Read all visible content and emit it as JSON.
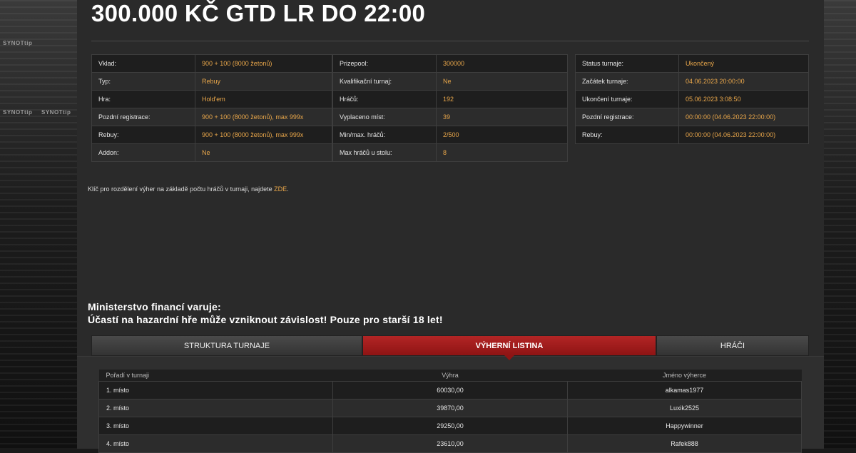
{
  "brand": "SYNOTtip",
  "title": "300.000 KČ GTD LR DO 22:00",
  "info_col1": [
    {
      "label": "Vklad:",
      "value": "900 + 100 (8000 žetonů)"
    },
    {
      "label": "Typ:",
      "value": "Rebuy"
    },
    {
      "label": "Hra:",
      "value": "Hold'em"
    },
    {
      "label": "Pozdní registrace:",
      "value": "900 + 100 (8000 žetonů), max 999x"
    },
    {
      "label": "Rebuy:",
      "value": "900 + 100 (8000 žetonů), max 999x"
    },
    {
      "label": "Addon:",
      "value": "Ne"
    }
  ],
  "info_col2": [
    {
      "label": "Prizepool:",
      "value": "300000"
    },
    {
      "label": "Kvalifikační turnaj:",
      "value": "Ne"
    },
    {
      "label": "Hráčů:",
      "value": "192"
    },
    {
      "label": "Vyplaceno míst:",
      "value": "39"
    },
    {
      "label": "Min/max. hráčů:",
      "value": "2/500"
    },
    {
      "label": "Max hráčů u stolu:",
      "value": "8"
    }
  ],
  "info_col3": [
    {
      "label": "Status turnaje:",
      "value": "Ukončený"
    },
    {
      "label": "Začátek turnaje:",
      "value": "04.06.2023 20:00:00"
    },
    {
      "label": "Ukončení turnaje:",
      "value": "05.06.2023 3:08:50"
    },
    {
      "label": "Pozdní registrace:",
      "value": "00:00:00 (04.06.2023 22:00:00)"
    },
    {
      "label": "Rebuy:",
      "value": "00:00:00 (04.06.2023 22:00:00)"
    }
  ],
  "note": {
    "text": "Klíč pro rozdělení výher na základě počtu hráčů v turnaji, najdete ",
    "link": "ZDE",
    "end": "."
  },
  "warning": {
    "line1": "Ministerstvo financí varuje:",
    "line2": "Účastí na hazardní hře může vzniknout závislost! Pouze pro starší 18 let!"
  },
  "tabs": {
    "structure": "STRUKTURA TURNAJE",
    "winners": "VÝHERNÍ LISTINA",
    "players": "HRÁČI"
  },
  "results": {
    "headers": [
      "Pořadí v turnaji",
      "Výhra",
      "Jméno výherce"
    ],
    "rows": [
      [
        "1. místo",
        "60030,00",
        "alkamas1977"
      ],
      [
        "2. místo",
        "39870,00",
        "Luxik2525"
      ],
      [
        "3. místo",
        "29250,00",
        "Happywinner"
      ],
      [
        "4. místo",
        "23610,00",
        "Rafek888"
      ]
    ]
  },
  "colors": {
    "accent": "#e8a64a",
    "active_tab": "#a31c1c",
    "panel": "#2a2a2a"
  }
}
